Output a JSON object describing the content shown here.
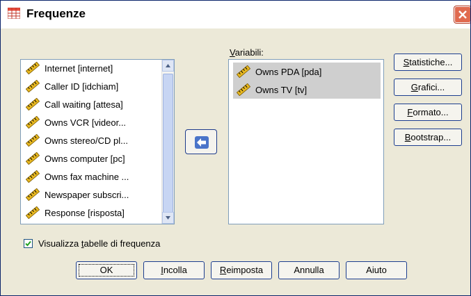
{
  "window": {
    "title": "Frequenze",
    "icon": "spreadsheet-grid-icon"
  },
  "source_list": {
    "items": [
      {
        "label": "Internet [internet]",
        "icon": "scale-ruler-icon"
      },
      {
        "label": "Caller ID [idchiam]",
        "icon": "scale-ruler-icon"
      },
      {
        "label": "Call waiting [attesa]",
        "icon": "scale-ruler-icon"
      },
      {
        "label": "Owns VCR [videor...",
        "icon": "scale-ruler-icon"
      },
      {
        "label": "Owns stereo/CD pl...",
        "icon": "scale-ruler-icon"
      },
      {
        "label": "Owns computer [pc]",
        "icon": "scale-ruler-icon"
      },
      {
        "label": "Owns fax machine ...",
        "icon": "scale-ruler-icon"
      },
      {
        "label": "Newspaper subscri...",
        "icon": "scale-ruler-icon"
      },
      {
        "label": "Response [risposta]",
        "icon": "scale-ruler-icon"
      }
    ]
  },
  "variables": {
    "label": "Variabili:",
    "items": [
      {
        "label": "Owns PDA [pda]",
        "icon": "scale-ruler-icon"
      },
      {
        "label": "Owns TV [tv]",
        "icon": "scale-ruler-icon"
      }
    ]
  },
  "side_buttons": {
    "statistiche": {
      "pre": "",
      "key": "S",
      "post": "tatistiche..."
    },
    "grafici": {
      "pre": "",
      "key": "G",
      "post": "rafici..."
    },
    "formato": {
      "pre": "",
      "key": "F",
      "post": "ormato..."
    },
    "bootstrap": {
      "pre": "",
      "key": "B",
      "post": "ootstrap..."
    }
  },
  "checkbox": {
    "pre": "Visualizza ",
    "key": "t",
    "post": "abelle di frequenza",
    "checked": true
  },
  "bottom_buttons": {
    "ok": {
      "pre": "",
      "key": "",
      "post": "OK"
    },
    "incolla": {
      "pre": "",
      "key": "I",
      "post": "ncolla"
    },
    "reimposta": {
      "pre": "",
      "key": "R",
      "post": "eimposta"
    },
    "annulla": {
      "pre": "",
      "key": "",
      "post": "Annulla"
    },
    "aiuto": {
      "pre": "",
      "key": "",
      "post": "Aiuto"
    }
  },
  "colors": {
    "accent_border": "#1c3d8f",
    "selection": "#cfcfcf",
    "close_red": "#e06a4f"
  }
}
